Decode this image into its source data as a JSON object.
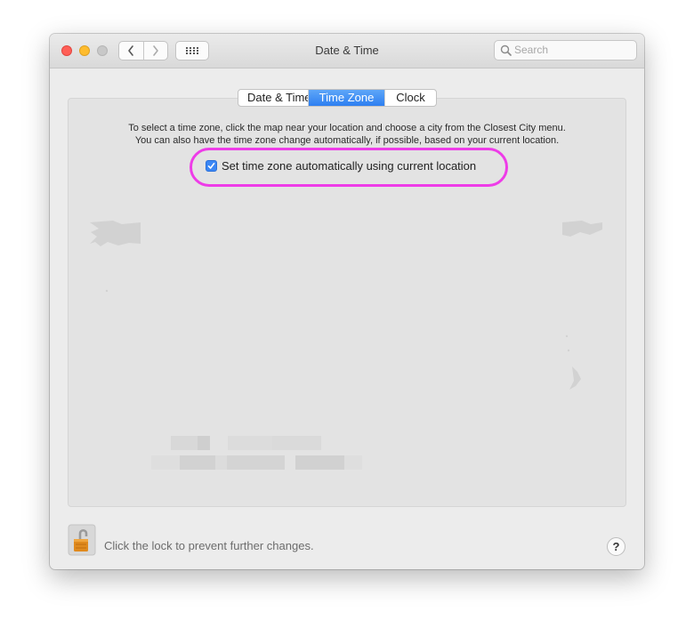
{
  "window": {
    "title": "Date & Time"
  },
  "search": {
    "placeholder": "Search",
    "value": ""
  },
  "tabs": [
    {
      "label": "Date & Time",
      "active": false
    },
    {
      "label": "Time Zone",
      "active": true
    },
    {
      "label": "Clock",
      "active": false
    }
  ],
  "instructions": {
    "line1": "To select a time zone, click the map near your location and choose a city from the Closest City menu.",
    "line2": "You can also have the time zone change automatically, if possible, based on your current location."
  },
  "auto_timezone": {
    "label": "Set time zone automatically using current location",
    "checked": true
  },
  "footer": {
    "lock_text": "Click the lock to prevent further changes.",
    "help_label": "?"
  },
  "colors": {
    "accent": "#2d7ff1",
    "highlight": "#ee3ce8"
  },
  "icons": {
    "back": "chevron-left-icon",
    "forward": "chevron-right-icon",
    "grid": "grid-icon",
    "search": "magnifier-icon",
    "lock": "unlocked-padlock-icon",
    "checkbox": "checkmark-icon"
  }
}
